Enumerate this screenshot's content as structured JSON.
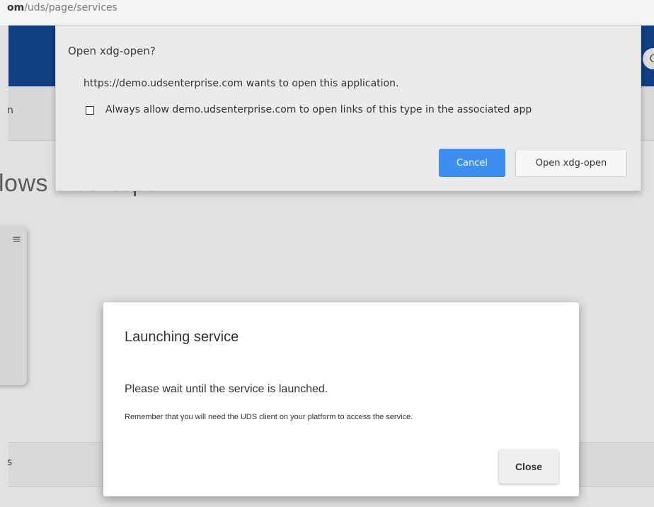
{
  "address_bar": {
    "url_bold": "om",
    "url_rest": "/uds/page/services"
  },
  "background_page": {
    "user_avatar_letter": "C",
    "nav_item_fragment": "n",
    "heading_fragment": "lows Desktops",
    "card_menu_icon": "≡",
    "bottom_section_fragment": "s"
  },
  "xdg_dialog": {
    "title": "Open xdg-open?",
    "message": "https://demo.udsenterprise.com wants to open this application.",
    "checkbox_label": "Always allow demo.udsenterprise.com to open links of this type in the associated app",
    "checkbox_checked": false,
    "cancel_label": "Cancel",
    "open_label": "Open xdg-open",
    "accent_color": "#3c8ff0"
  },
  "launch_modal": {
    "title": "Launching service",
    "message": "Please wait until the service is launched.",
    "note": "Remember that you will need the UDS client on your platform to access the service.",
    "close_label": "Close"
  },
  "colors": {
    "brand_bar": "#0f3f80",
    "overlay_gray": "#e1e1e1"
  }
}
